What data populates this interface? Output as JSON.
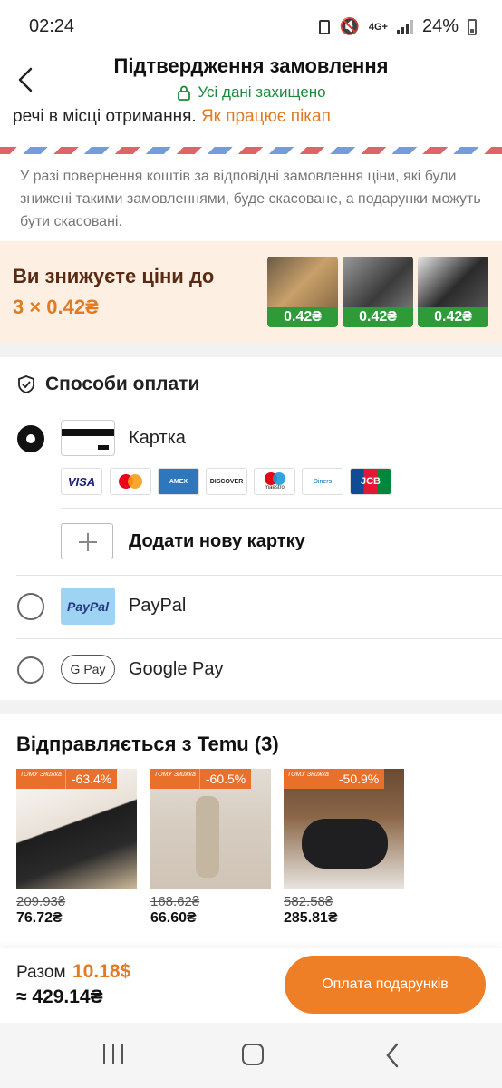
{
  "status_bar": {
    "time": "02:24",
    "network": "4G+",
    "battery": "24%"
  },
  "header": {
    "title": "Підтвердження замовлення",
    "secure_text": "Усі дані захищено"
  },
  "pickup": {
    "text": "речі в місці отримання.",
    "link": "Як працює пікап"
  },
  "refund_notice": "У разі повернення коштів за відповідні замовлення ціни, які були знижені такими замовленнями, буде скасоване, а подарунки можуть бути скасовані.",
  "promo": {
    "line1": "Ви знижуєте ціни до",
    "line2": "3 × 0.42₴",
    "items": [
      {
        "price": "0.42₴",
        "color": "#c8a06a"
      },
      {
        "price": "0.42₴",
        "color": "#3a3a3a"
      },
      {
        "price": "0.42₴",
        "color": "#2b2b2b"
      }
    ]
  },
  "payment": {
    "title": "Способи оплати",
    "card_label": "Картка",
    "brands": [
      "VISA",
      "MC",
      "AMEX",
      "DISCOVER",
      "maestro",
      "Diners",
      "JCB"
    ],
    "add_card_label": "Додати нову картку",
    "paypal_label": "PayPal",
    "paypal_logo": "PayPal",
    "gpay_label": "Google Pay",
    "gpay_logo": "G Pay"
  },
  "shipping": {
    "title": "Відправляється з Temu (3)",
    "badge_small": "ТОМУ Знижка",
    "products": [
      {
        "discount": "-63.4%",
        "old_price": "209.93₴",
        "new_price": "76.72₴",
        "color": "#d9d1c7"
      },
      {
        "discount": "-60.5%",
        "old_price": "168.62₴",
        "new_price": "66.60₴",
        "color": "#ddd6cc"
      },
      {
        "discount": "-50.9%",
        "old_price": "582.58₴",
        "new_price": "285.81₴",
        "color": "#7a5a3e"
      }
    ]
  },
  "bottom_bar": {
    "total_label": "Разом",
    "total_usd": "10.18$",
    "total_uah": "≈ 429.14₴",
    "pay_button": "Оплата подарунків"
  }
}
